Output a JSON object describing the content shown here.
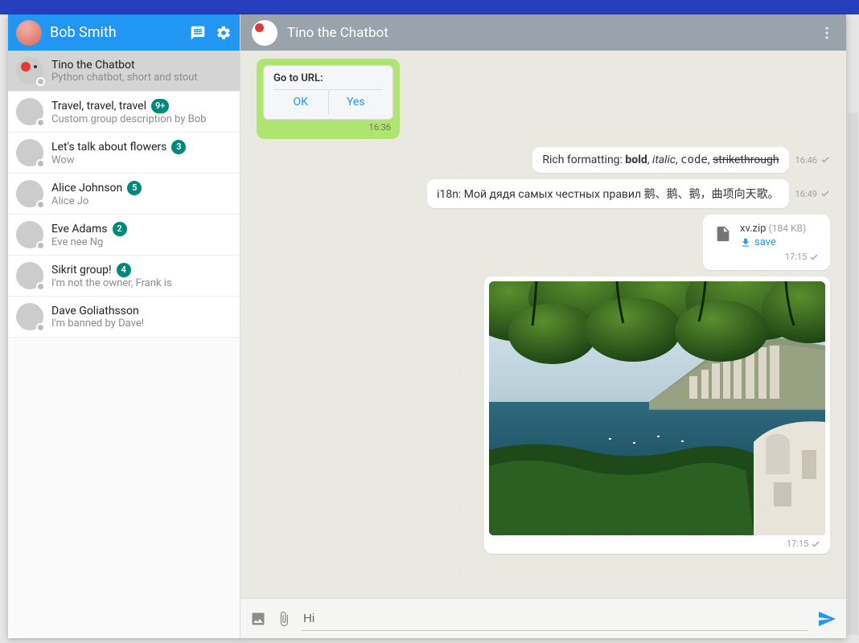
{
  "sidebar": {
    "user_name": "Bob Smith",
    "chats": [
      {
        "name": "Tino the Chatbot",
        "subtitle": "Python chatbot, short and stout",
        "badge": "",
        "active": true,
        "av": "av-tino"
      },
      {
        "name": "Travel, travel, travel",
        "subtitle": "Custom group description by Bob",
        "badge": "9+",
        "active": false,
        "av": "av-travel"
      },
      {
        "name": "Let's talk about flowers",
        "subtitle": "Wow",
        "badge": "3",
        "active": false,
        "av": "av-flower"
      },
      {
        "name": "Alice Johnson",
        "subtitle": "Alice Jo",
        "badge": "5",
        "active": false,
        "av": "av-alice"
      },
      {
        "name": "Eve Adams",
        "subtitle": "Eve nee Ng",
        "badge": "2",
        "active": false,
        "av": "av-eve"
      },
      {
        "name": "Sikrit group!",
        "subtitle": "I'm not the owner, Frank is",
        "badge": "4",
        "active": false,
        "av": "av-sikrit"
      },
      {
        "name": "Dave Goliathsson",
        "subtitle": "I'm banned by Dave!",
        "badge": "",
        "active": false,
        "av": "av-dave"
      }
    ]
  },
  "chat": {
    "title": "Tino the Chatbot",
    "card": {
      "title": "Go to URL:",
      "ok": "OK",
      "yes": "Yes",
      "time": "16:36"
    },
    "msg_format": {
      "prefix": "Rich formatting: ",
      "bold": "bold",
      "sep1": ", ",
      "italic": "italic",
      "sep2": ", ",
      "code": "code",
      "sep3": ", ",
      "strike": "strikethrough",
      "time": "16:46"
    },
    "msg_i18n": {
      "text": "i18n: Мой дядя самых честных правил 鹅、鹅、鹅，曲项向天歌。",
      "time": "16:49"
    },
    "file": {
      "name": "xv.zip",
      "size": "(184 KB)",
      "save": "save",
      "time": "17:15"
    },
    "image": {
      "time": "17:15"
    },
    "composer": {
      "value": "Hi"
    }
  }
}
